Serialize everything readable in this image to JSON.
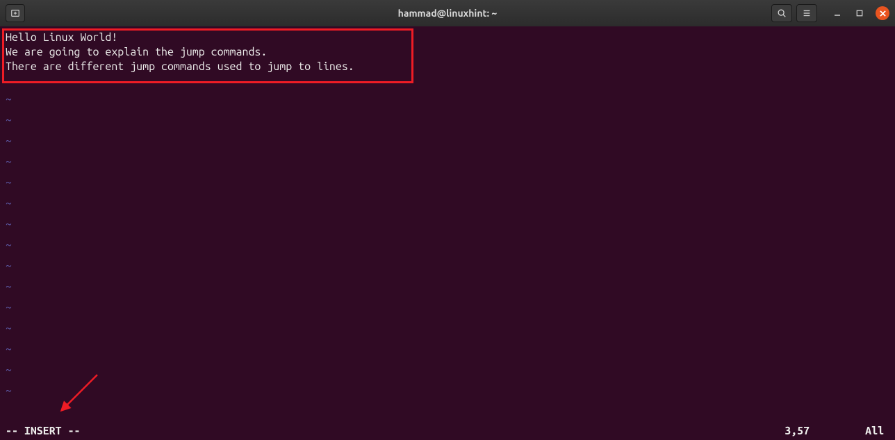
{
  "titlebar": {
    "title": "hammad@linuxhint: ~"
  },
  "editor": {
    "lines": [
      "Hello Linux World!",
      "We are going to explain the jump commands.",
      "There are different jump commands used to jump to lines."
    ],
    "tilde_count": 15
  },
  "status": {
    "mode": "-- INSERT --",
    "position": "3,57",
    "view": "All"
  }
}
